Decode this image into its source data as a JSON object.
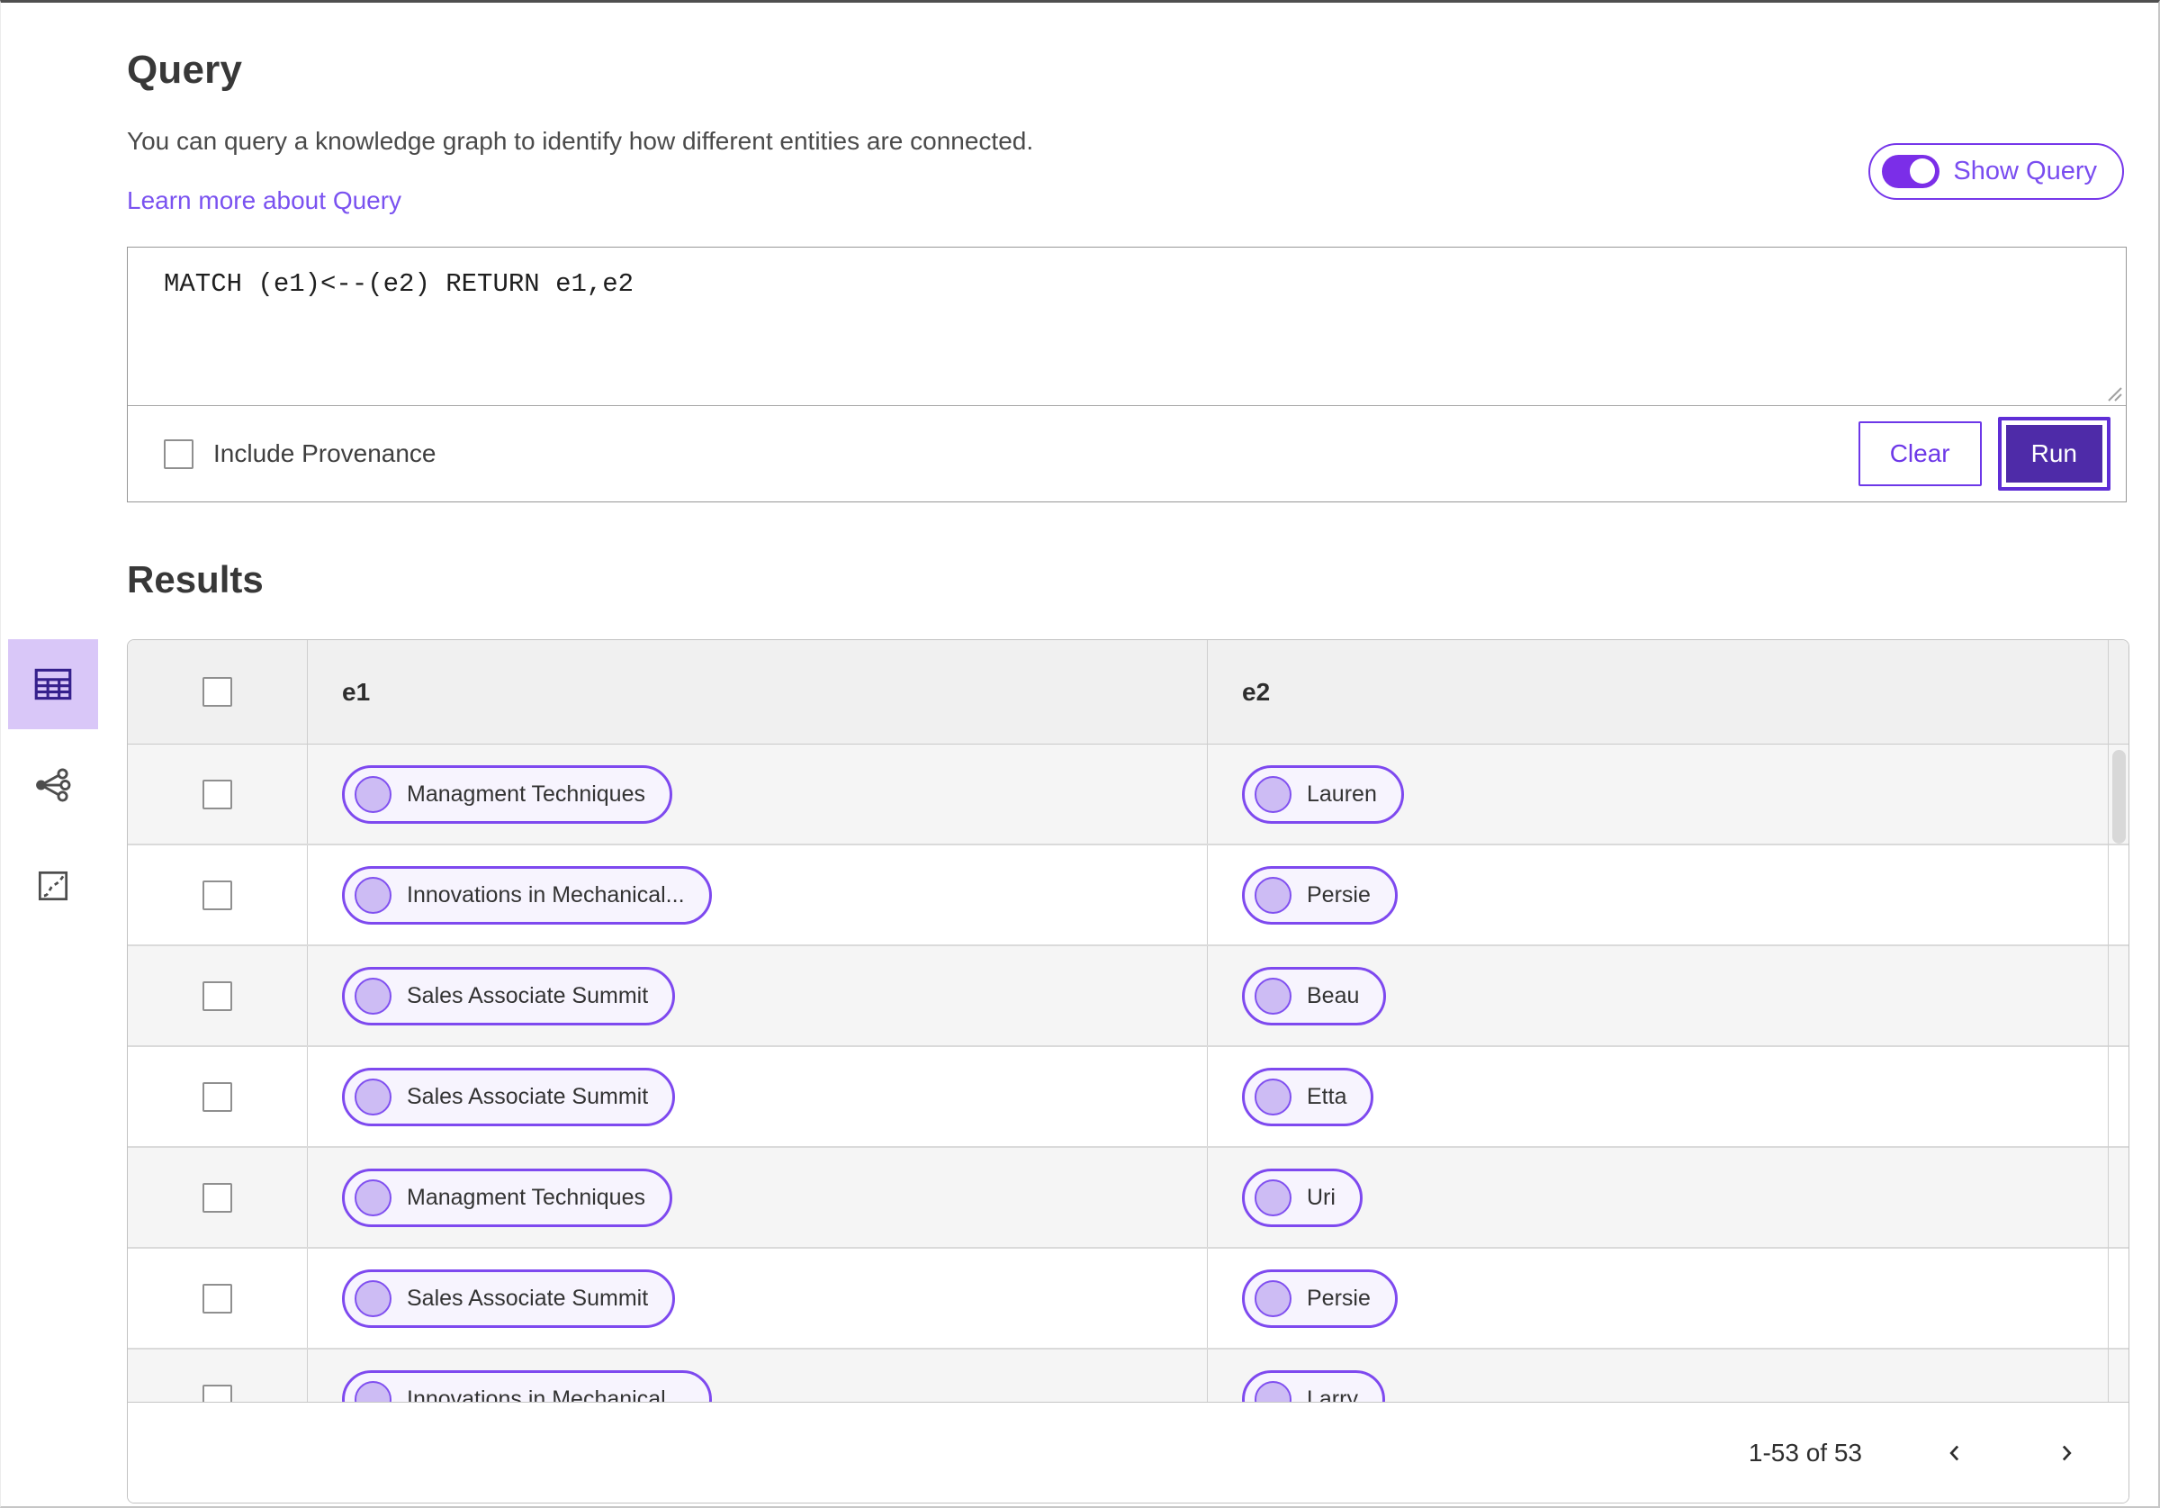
{
  "colors": {
    "accent_purple": "#6d38e8",
    "deep_purple_run": "#4e2ba8",
    "link_purple": "#7a52f0",
    "pill_border": "#7e49ef",
    "pill_bg": "#f7f4fe",
    "pill_dot_fill": "#cdbcf4",
    "active_view_bg": "#d9c7f8",
    "table_header_bg": "#f0f0f0",
    "striped_row_bg": "#f5f5f5"
  },
  "query_section": {
    "title": "Query",
    "description": "You can query a knowledge graph to identify how different entities are connected.",
    "learn_more_label": "Learn more about Query",
    "show_query_label": "Show Query",
    "toggle_state": "on",
    "query_text": "MATCH (e1)<--(e2) RETURN e1,e2",
    "include_provenance_label": "Include Provenance",
    "include_provenance_checked": false,
    "clear_label": "Clear",
    "run_label": "Run"
  },
  "results_section": {
    "title": "Results",
    "view_switcher": {
      "active_view": "table",
      "views": [
        "table",
        "graph",
        "map"
      ]
    },
    "table": {
      "columns": [
        "e1",
        "e2"
      ],
      "rows": [
        {
          "e1": "Managment Techniques",
          "e2": "Lauren"
        },
        {
          "e1": "Innovations in Mechanical...",
          "e2": "Persie"
        },
        {
          "e1": "Sales Associate Summit",
          "e2": "Beau"
        },
        {
          "e1": "Sales Associate Summit",
          "e2": "Etta"
        },
        {
          "e1": "Managment Techniques",
          "e2": "Uri"
        },
        {
          "e1": "Sales Associate Summit",
          "e2": "Persie"
        },
        {
          "e1": "Innovations in Mechanical...",
          "e2": "Larry"
        }
      ]
    },
    "pagination": {
      "range_label": "1-53 of 53"
    }
  }
}
